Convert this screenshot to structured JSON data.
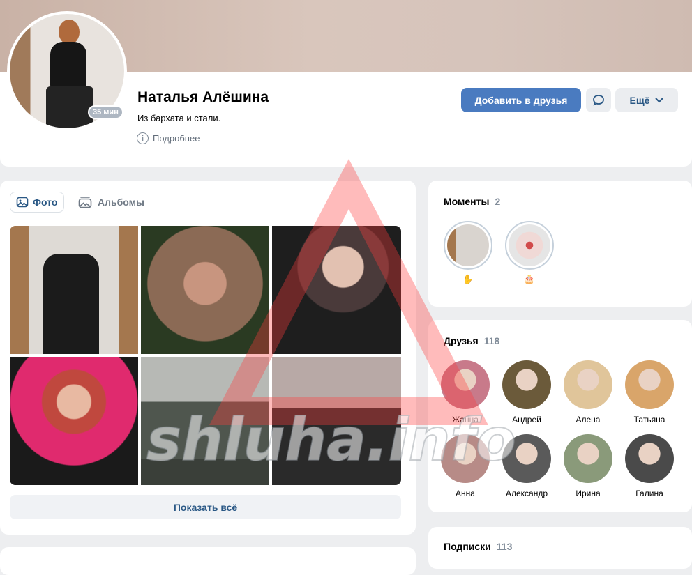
{
  "profile": {
    "name": "Наталья Алёшина",
    "status": "Из бархата и стали.",
    "more_info_label": "Подробнее",
    "online_badge": "35 мин",
    "add_friend_label": "Добавить в друзья",
    "more_label": "Ещё"
  },
  "photos": {
    "tabs": [
      {
        "label": "Фото",
        "icon": "image-icon",
        "active": true
      },
      {
        "label": "Альбомы",
        "icon": "albums-icon",
        "active": false
      }
    ],
    "show_all_label": "Показать всё"
  },
  "moments": {
    "title": "Моменты",
    "count": "2",
    "items": [
      {
        "emoji": "✋"
      },
      {
        "emoji": "🎂"
      }
    ]
  },
  "friends": {
    "title": "Друзья",
    "count": "118",
    "items": [
      {
        "name": "Жанна",
        "color": "#c87a8a"
      },
      {
        "name": "Андрей",
        "color": "#6b5a3a"
      },
      {
        "name": "Алена",
        "color": "#e0c59a"
      },
      {
        "name": "Татьяна",
        "color": "#d9a56a"
      },
      {
        "name": "Анна",
        "color": "#b78b87"
      },
      {
        "name": "Александр",
        "color": "#5a5a5a"
      },
      {
        "name": "Ирина",
        "color": "#8a9a7a"
      },
      {
        "name": "Галина",
        "color": "#4a4a4a"
      }
    ]
  },
  "subscriptions": {
    "title": "Подписки",
    "count": "113"
  },
  "watermark": {
    "text": "shluha.info",
    "color": "#ff3b3b"
  }
}
